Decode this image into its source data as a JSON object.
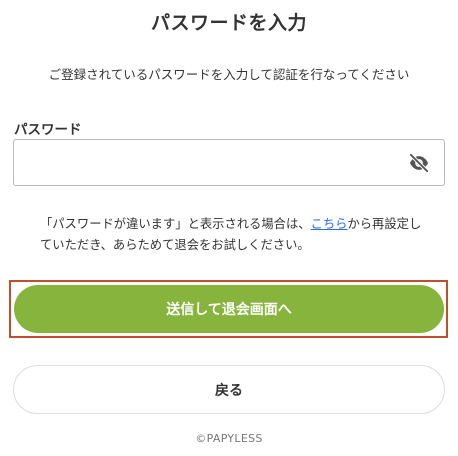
{
  "page": {
    "title": "パスワードを入力",
    "subtitle": "ご登録されているパスワードを入力して認証を行なってください"
  },
  "form": {
    "password_label": "パスワード",
    "password_value": "",
    "password_placeholder": "",
    "visibility_icon": "eye-slash-icon"
  },
  "notice": {
    "text_before_link": "「パスワードが違います」と表示される場合は、",
    "link_text": "こちら",
    "text_after_link": "から再設定していただき、あらためて退会をお試しください。"
  },
  "actions": {
    "submit_label": "送信して退会画面へ",
    "back_label": "戻る"
  },
  "footer": {
    "copyright": "©PAPYLESS"
  },
  "colors": {
    "accent": "#86b43c",
    "highlight_outline": "#c0502d",
    "link": "#2a6fd6"
  }
}
